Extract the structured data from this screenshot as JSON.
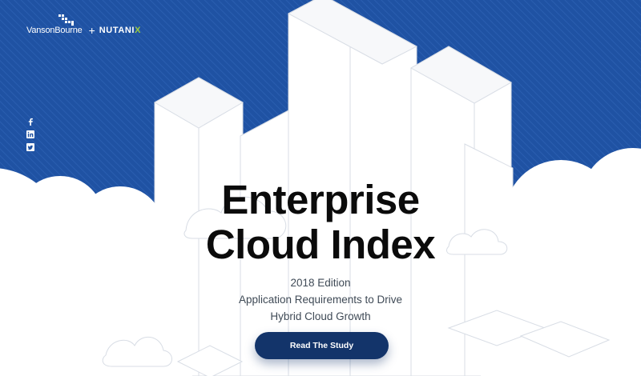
{
  "header": {
    "brand_vansonbourne": "VansonBourne",
    "brand_separator": "+",
    "brand_nutanix_main": "NUTANI",
    "brand_nutanix_x": "X"
  },
  "social": {
    "icons": [
      "facebook-icon",
      "linkedin-icon",
      "twitter-icon"
    ]
  },
  "hero": {
    "title_line1": "Enterprise",
    "title_line2": "Cloud Index",
    "edition": "2018 Edition",
    "subtitle_line1": "Application Requirements to Drive",
    "subtitle_line2": "Hybrid Cloud Growth"
  },
  "cta": {
    "label": "Read The Study"
  },
  "colors": {
    "sky_blue": "#1f52a3",
    "button_navy": "#13346a",
    "nutanix_green": "#9ccc3a",
    "title_text": "#0b0b0b",
    "subtitle_text": "#3f4a56"
  }
}
